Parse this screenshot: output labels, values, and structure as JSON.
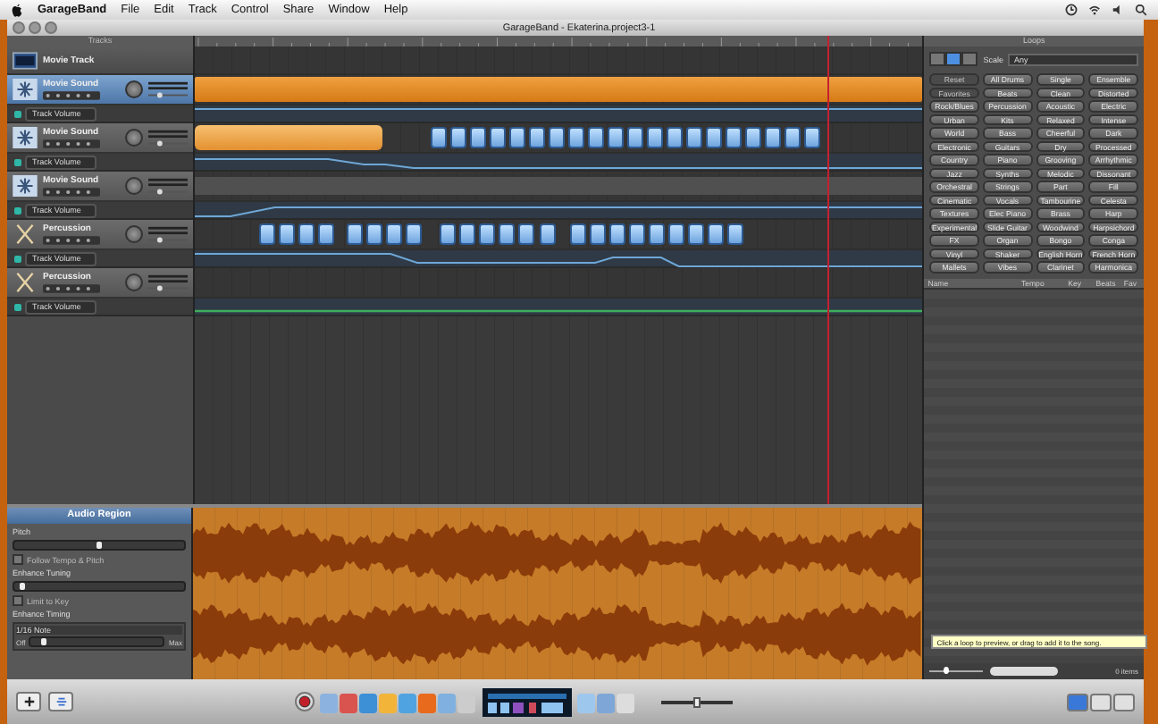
{
  "menu_bar": {
    "app": "GarageBand",
    "items": [
      "File",
      "Edit",
      "Track",
      "Control",
      "Share",
      "Window",
      "Help"
    ]
  },
  "window": {
    "title": "GarageBand - Ekaterina.project3-1"
  },
  "tracks_header": "Tracks",
  "tracks": [
    {
      "kind": "movie",
      "name": "Movie Track",
      "selected": false
    },
    {
      "kind": "audio",
      "name": "Movie Sound",
      "selected": true,
      "volume_label": "Track Volume"
    },
    {
      "kind": "audio",
      "name": "Movie Sound",
      "selected": false,
      "volume_label": "Track Volume"
    },
    {
      "kind": "audio",
      "name": "Movie Sound",
      "selected": false,
      "volume_label": "Track Volume"
    },
    {
      "kind": "drums",
      "name": "Percussion",
      "selected": false,
      "volume_label": "Track Volume"
    },
    {
      "kind": "drums",
      "name": "Percussion",
      "selected": false,
      "volume_label": "Track Volume"
    }
  ],
  "loops": {
    "title": "Loops",
    "view_buttons": [
      {
        "selected": false
      },
      {
        "selected": true
      },
      {
        "selected": false
      }
    ],
    "scale_label": "Scale",
    "scale_value": "Any",
    "keywords": [
      {
        "label": "Reset",
        "disabled": true
      },
      {
        "label": "All Drums",
        "disabled": false
      },
      {
        "label": "Single",
        "disabled": false
      },
      {
        "label": "Ensemble",
        "disabled": false
      },
      {
        "label": "Favorites",
        "disabled": true
      },
      {
        "label": "Beats",
        "disabled": false
      },
      {
        "label": "Clean",
        "disabled": false
      },
      {
        "label": "Distorted",
        "disabled": false
      },
      {
        "label": "Rock/Blues",
        "disabled": false
      },
      {
        "label": "Percussion",
        "disabled": false
      },
      {
        "label": "Acoustic",
        "disabled": false
      },
      {
        "label": "Electric",
        "disabled": false
      },
      {
        "label": "Urban",
        "disabled": false
      },
      {
        "label": "Kits",
        "disabled": false
      },
      {
        "label": "Relaxed",
        "disabled": false
      },
      {
        "label": "Intense",
        "disabled": false
      },
      {
        "label": "World",
        "disabled": false
      },
      {
        "label": "Bass",
        "disabled": false
      },
      {
        "label": "Cheerful",
        "disabled": false
      },
      {
        "label": "Dark",
        "disabled": false
      },
      {
        "label": "Electronic",
        "disabled": false
      },
      {
        "label": "Guitars",
        "disabled": false
      },
      {
        "label": "Dry",
        "disabled": false
      },
      {
        "label": "Processed",
        "disabled": false
      },
      {
        "label": "Country",
        "disabled": false
      },
      {
        "label": "Piano",
        "disabled": false
      },
      {
        "label": "Grooving",
        "disabled": false
      },
      {
        "label": "Arrhythmic",
        "disabled": false
      },
      {
        "label": "Jazz",
        "disabled": false
      },
      {
        "label": "Synths",
        "disabled": false
      },
      {
        "label": "Melodic",
        "disabled": false
      },
      {
        "label": "Dissonant",
        "disabled": false
      },
      {
        "label": "Orchestral",
        "disabled": false
      },
      {
        "label": "Strings",
        "disabled": false
      },
      {
        "label": "Part",
        "disabled": false
      },
      {
        "label": "Fill",
        "disabled": false
      },
      {
        "label": "Cinematic",
        "disabled": false
      },
      {
        "label": "Vocals",
        "disabled": false
      },
      {
        "label": "Tambourine",
        "disabled": false
      },
      {
        "label": "Celesta",
        "disabled": false
      },
      {
        "label": "Textures",
        "disabled": false
      },
      {
        "label": "Elec Piano",
        "disabled": false
      },
      {
        "label": "Brass",
        "disabled": false
      },
      {
        "label": "Harp",
        "disabled": false
      },
      {
        "label": "Experimental",
        "disabled": false
      },
      {
        "label": "Slide Guitar",
        "disabled": false
      },
      {
        "label": "Woodwind",
        "disabled": false
      },
      {
        "label": "Harpsichord",
        "disabled": false
      },
      {
        "label": "FX",
        "disabled": false
      },
      {
        "label": "Organ",
        "disabled": false
      },
      {
        "label": "Bongo",
        "disabled": false
      },
      {
        "label": "Conga",
        "disabled": false
      },
      {
        "label": "Vinyl",
        "disabled": false
      },
      {
        "label": "Shaker",
        "disabled": false
      },
      {
        "label": "English Horn",
        "disabled": false
      },
      {
        "label": "French Horn",
        "disabled": false
      },
      {
        "label": "Mallets",
        "disabled": false
      },
      {
        "label": "Vibes",
        "disabled": false
      },
      {
        "label": "Clarinet",
        "disabled": false
      },
      {
        "label": "Harmonica",
        "disabled": false
      }
    ],
    "columns": [
      "Name",
      "Tempo",
      "Key",
      "Beats",
      "Fav"
    ],
    "tooltip": "Click a loop to preview, or drag to add it to the song.",
    "preview_volume": {
      "level": 0.3
    },
    "items_count": "0 items"
  },
  "audio_region": {
    "title": "Audio Region",
    "controls": [
      {
        "kind": "slider",
        "label": "Pitch",
        "level": 0.5
      },
      {
        "kind": "checkbox",
        "label": "Follow Tempo & Pitch",
        "checked": false
      },
      {
        "kind": "slider",
        "label": "Enhance Tuning",
        "level": 0.05
      },
      {
        "kind": "checkbox",
        "label": "Limit to Key",
        "checked": false
      },
      {
        "kind": "timing",
        "label": "Enhance Timing",
        "value": "1/16 Note",
        "min": "Off",
        "max": "Max",
        "level": 0.1
      }
    ]
  },
  "toolbar": {
    "right_buttons": [
      {
        "selected": true
      },
      {
        "selected": false
      },
      {
        "selected": false
      }
    ],
    "master_volume": {
      "level": 0.5
    }
  }
}
